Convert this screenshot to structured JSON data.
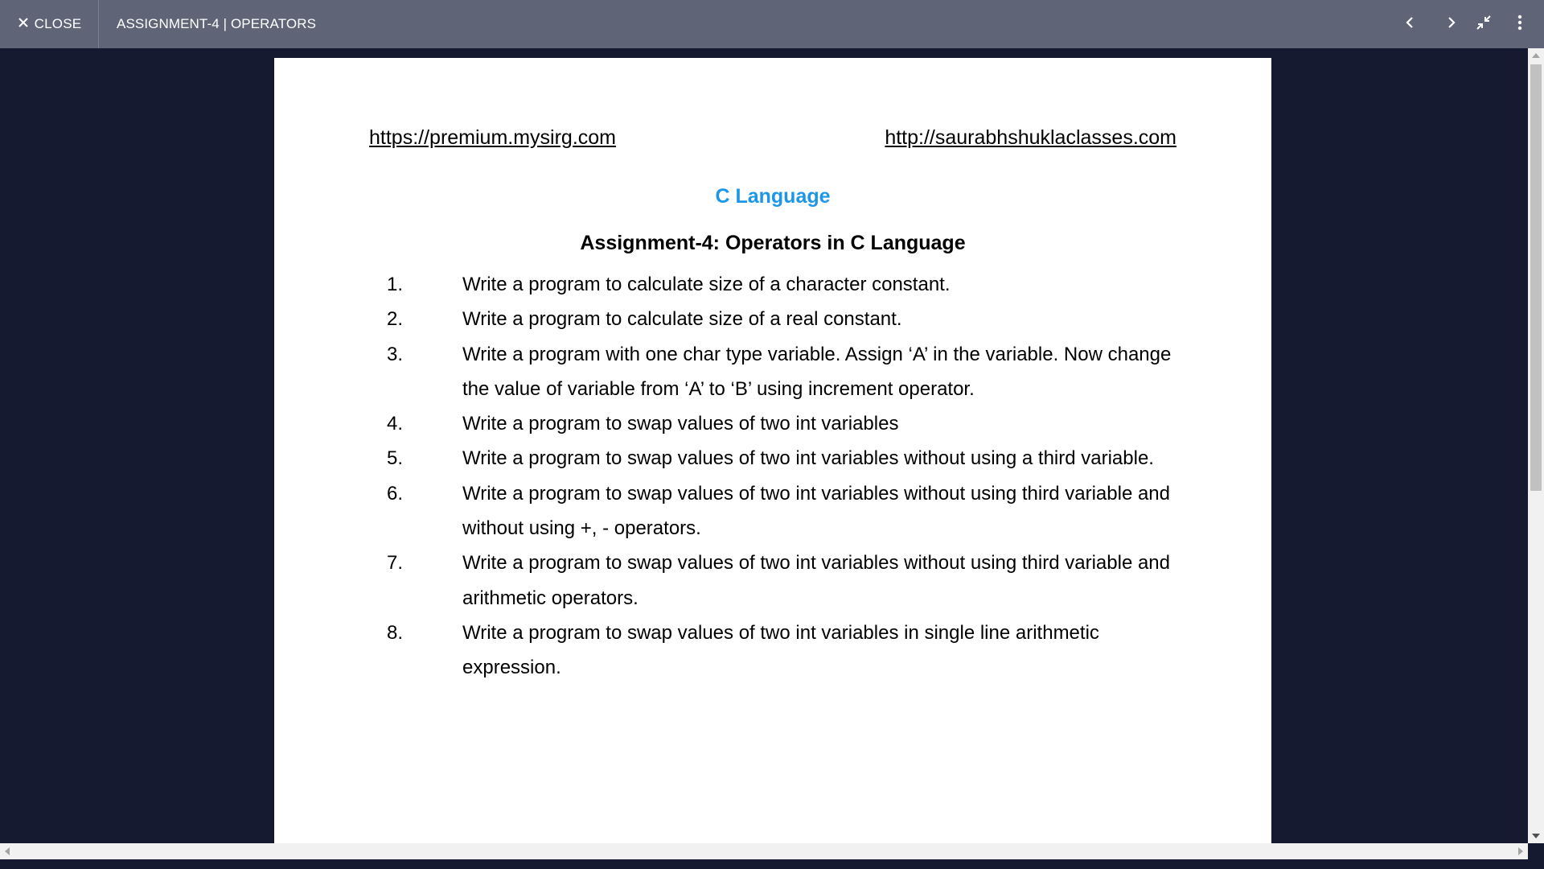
{
  "toolbar": {
    "close_label": "CLOSE",
    "title": "ASSIGNMENT-4 | OPERATORS",
    "icons": [
      "close-icon",
      "chevron-left-icon",
      "chevron-right-icon",
      "exit-fullscreen-icon",
      "more-vert-icon"
    ]
  },
  "document": {
    "link_left": "https://premium.mysirg.com",
    "link_right": "http://saurabhshuklaclasses.com",
    "subject": "C Language",
    "heading": "Assignment-4: Operators in C Language",
    "questions": [
      {
        "num": "1.",
        "text": "Write a program to calculate size of a character constant."
      },
      {
        "num": "2.",
        "text": "Write a program to calculate size of a real constant."
      },
      {
        "num": "3.",
        "text": "Write a program with one char type variable. Assign ‘A’ in the variable. Now change the value of variable from ‘A’ to ‘B’ using increment operator."
      },
      {
        "num": "4.",
        "text": "Write a program to swap values of two int variables"
      },
      {
        "num": "5.",
        "text": "Write a program to swap values of two int variables without using a third variable."
      },
      {
        "num": "6.",
        "text": "Write a program to swap values of two int variables without using third variable and without using +, - operators."
      },
      {
        "num": "7.",
        "text": "Write a program to swap values of two int variables without using third variable and arithmetic operators."
      },
      {
        "num": "8.",
        "text": "Write a program to swap values of two int variables in single line arithmetic expression."
      }
    ]
  },
  "colors": {
    "toolbar_bg": "#5f6577",
    "viewer_bg": "#151a30",
    "subject_blue": "#1e96e8"
  }
}
